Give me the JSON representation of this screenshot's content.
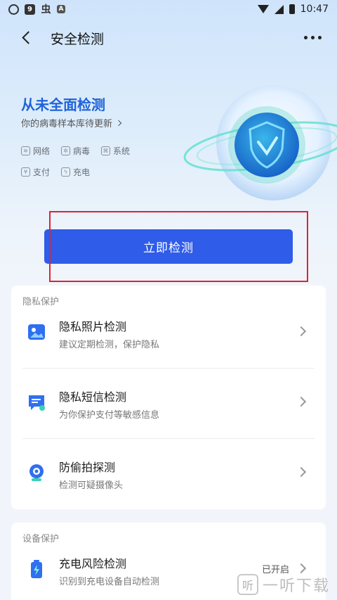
{
  "status_bar": {
    "icons": [
      "spirit-icon",
      "nine-icon",
      "bug-icon",
      "a-icon"
    ],
    "time": "10:47"
  },
  "header": {
    "title": "安全检测"
  },
  "hero": {
    "title": "从未全面检测",
    "subtitle": "你的病毒样本库待更新",
    "tags_row1": [
      {
        "label": "网络",
        "icon": "wifi-icon"
      },
      {
        "label": "病毒",
        "icon": "virus-icon"
      },
      {
        "label": "系统",
        "icon": "system-icon"
      }
    ],
    "tags_row2": [
      {
        "label": "支付",
        "icon": "yuan-icon"
      },
      {
        "label": "充电",
        "icon": "charge-icon"
      }
    ]
  },
  "scan_button": {
    "label": "立即检测"
  },
  "privacy": {
    "heading": "隐私保护",
    "items": [
      {
        "title": "隐私照片检测",
        "desc": "建议定期检测，保护隐私",
        "icon": "photo-icon"
      },
      {
        "title": "隐私短信检测",
        "desc": "为你保护支付等敏感信息",
        "icon": "sms-icon"
      },
      {
        "title": "防偷拍探测",
        "desc": "检测可疑摄像头",
        "icon": "camera-icon"
      }
    ]
  },
  "device": {
    "heading": "设备保护",
    "items": [
      {
        "title": "充电风险检测",
        "desc": "识别到充电设备自动检测",
        "status": "已开启",
        "icon": "battery-icon"
      }
    ]
  },
  "watermark": {
    "logo": "听",
    "text": "一听下载"
  },
  "colors": {
    "accent": "#2f5ce8",
    "hero_title": "#1f63d8",
    "highlight": "#e0232d"
  }
}
